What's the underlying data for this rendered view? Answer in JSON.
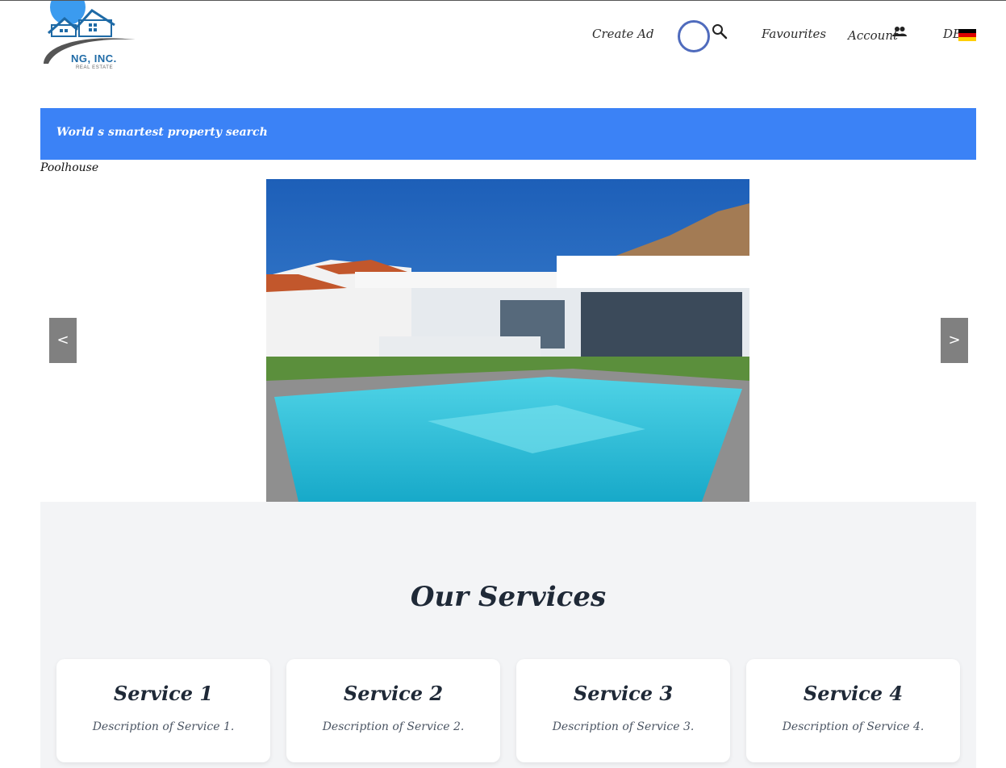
{
  "brand": {
    "name": "NG, INC.",
    "subtitle": "REAL ESTATE"
  },
  "nav": {
    "create_ad": "Create Ad",
    "favourites": "Favourites",
    "account": "Account",
    "language": "DE"
  },
  "icons": {
    "search": "search-icon",
    "account": "people-icon",
    "language_flag": "germany-flag-icon"
  },
  "colors": {
    "accent": "#3b82f6",
    "ring": "#4f6bbd",
    "arrow": "#808080",
    "logo": "#1e6aa6"
  },
  "banner": {
    "text": "World s smartest property search"
  },
  "slider": {
    "caption": "Poolhouse",
    "prev_label": "<",
    "next_label": ">"
  },
  "services": {
    "title": "Our Services",
    "items": [
      {
        "title": "Service 1",
        "description": "Description of Service 1."
      },
      {
        "title": "Service 2",
        "description": "Description of Service 2."
      },
      {
        "title": "Service 3",
        "description": "Description of Service 3."
      },
      {
        "title": "Service 4",
        "description": "Description of Service 4."
      }
    ]
  }
}
